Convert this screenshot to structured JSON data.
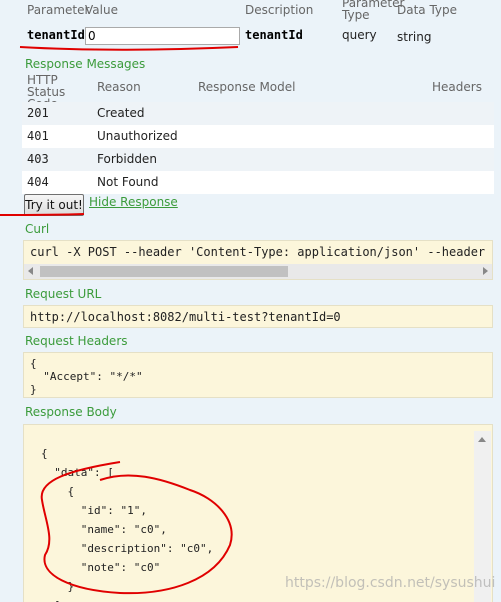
{
  "parameters": {
    "headers": [
      "Parameter",
      "Value",
      "Description",
      "Parameter Type",
      "Data Type"
    ],
    "row": {
      "name": "tenantId",
      "value": "0",
      "description": "tenantId",
      "type": "query",
      "data_type": "string"
    }
  },
  "response_messages": {
    "title": "Response Messages",
    "headers": {
      "status": "HTTP Status Code",
      "reason": "Reason",
      "model": "Response Model",
      "headers": "Headers"
    },
    "rows": [
      {
        "code": "201",
        "reason": "Created"
      },
      {
        "code": "401",
        "reason": "Unauthorized"
      },
      {
        "code": "403",
        "reason": "Forbidden"
      },
      {
        "code": "404",
        "reason": "Not Found"
      }
    ]
  },
  "actions": {
    "try_label": "Try it out!",
    "hide_label": "Hide Response"
  },
  "curl": {
    "title": "Curl",
    "command": "curl -X POST --header 'Content-Type: application/json' --header 'Accept"
  },
  "request_url": {
    "title": "Request URL",
    "url": "http://localhost:8082/multi-test?tenantId=0"
  },
  "request_headers": {
    "title": "Request Headers",
    "lines": [
      "{",
      "  \"Accept\": \"*/*\"",
      "}"
    ]
  },
  "response_body": {
    "title": "Response Body",
    "lines": [
      "{",
      "  \"data\": [",
      "    {",
      "      \"id\": \"1\",",
      "      \"name\": \"c0\",",
      "      \"description\": \"c0\",",
      "      \"note\": \"c0\"",
      "    }",
      "  ]"
    ]
  },
  "watermark": "https://blog.csdn.net/sysushui",
  "colors": {
    "accent_green": "#3b9b3b",
    "annotation_red": "#e00000",
    "code_bg": "#fcf6db"
  }
}
